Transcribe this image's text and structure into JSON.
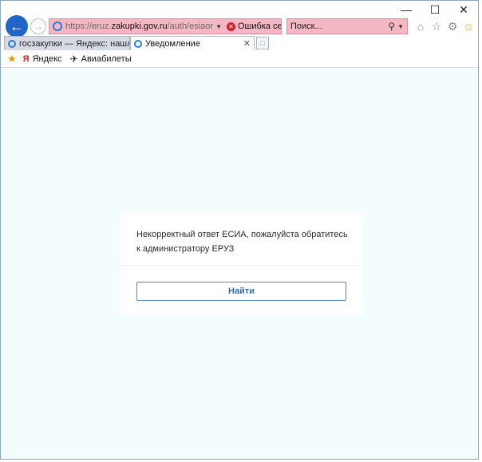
{
  "browser": {
    "address": {
      "url_prefix": "https://eruz.",
      "url_domain": "zakupki.gov.ru",
      "url_path": "/auth/esiaor",
      "cert_error": "Ошибка серт..."
    },
    "search": {
      "placeholder": "Поиск..."
    },
    "tabs": [
      {
        "label": "госзакупки — Яндекс: нашло..."
      },
      {
        "label": "Уведомление"
      }
    ],
    "favorites": [
      {
        "label": "Яндекс",
        "icon": "yandex-icon"
      },
      {
        "label": "Авиабилеты",
        "icon": "plane-icon"
      }
    ]
  },
  "dialog": {
    "message": "Некорректный ответ ЕСИА, пожалуйста обратитесь к администратору ЕРУЗ",
    "button_label": "Найти"
  },
  "colors": {
    "content_bg": "#f3fdfd",
    "address_error_bg": "#f5b7c4",
    "accent": "#2f6fb4"
  }
}
